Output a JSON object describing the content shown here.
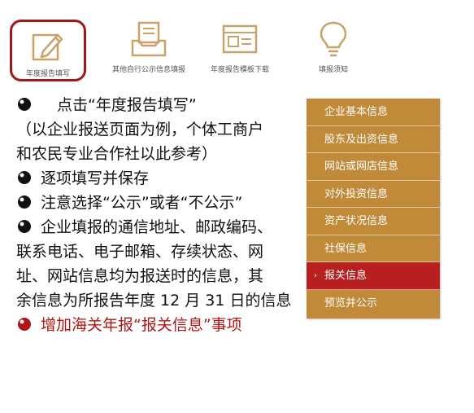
{
  "toolbar": {
    "items": [
      {
        "label": "年度报告填写",
        "icon": "edit-icon",
        "active": true
      },
      {
        "label": "其他自行公示信息填报",
        "icon": "inbox-icon",
        "active": false
      },
      {
        "label": "年度报告模板下载",
        "icon": "template-icon",
        "active": false
      },
      {
        "label": "填报须知",
        "icon": "lightbulb-icon",
        "active": false
      }
    ],
    "icon_color": "#c9a26a",
    "active_border_color": "#a01818"
  },
  "instructions": {
    "step1": "点击“年度报告填写”",
    "note_line1": "（以企业报送页面为例，个体工商户",
    "note_line2": "和农民专业合作社以此参考）",
    "step2": "逐项填写并保存",
    "step3": "注意选择“公示”或者“不公示”",
    "step4_line1": "企业填报的通信地址、邮政编码、",
    "step4_line2": "联系电话、电子邮箱、存续状态、网",
    "step4_line3": "址、网站信息均为报送时的信息，其",
    "step4_line4": "余信息为所报告年度 12 月 31 日的信息",
    "step5": "增加海关年报“报关信息”事项",
    "highlight_color": "#b01515"
  },
  "side_menu": {
    "items": [
      {
        "label": "企业基本信息"
      },
      {
        "label": "股东及出资信息"
      },
      {
        "label": "网站或网店信息"
      },
      {
        "label": "对外投资信息"
      },
      {
        "label": "资产状况信息"
      },
      {
        "label": "社保信息"
      },
      {
        "label": "报关信息",
        "active": true,
        "marker": "›"
      },
      {
        "label": "预览并公示"
      }
    ],
    "bg_color": "#c08a38",
    "active_color": "#b82020"
  }
}
